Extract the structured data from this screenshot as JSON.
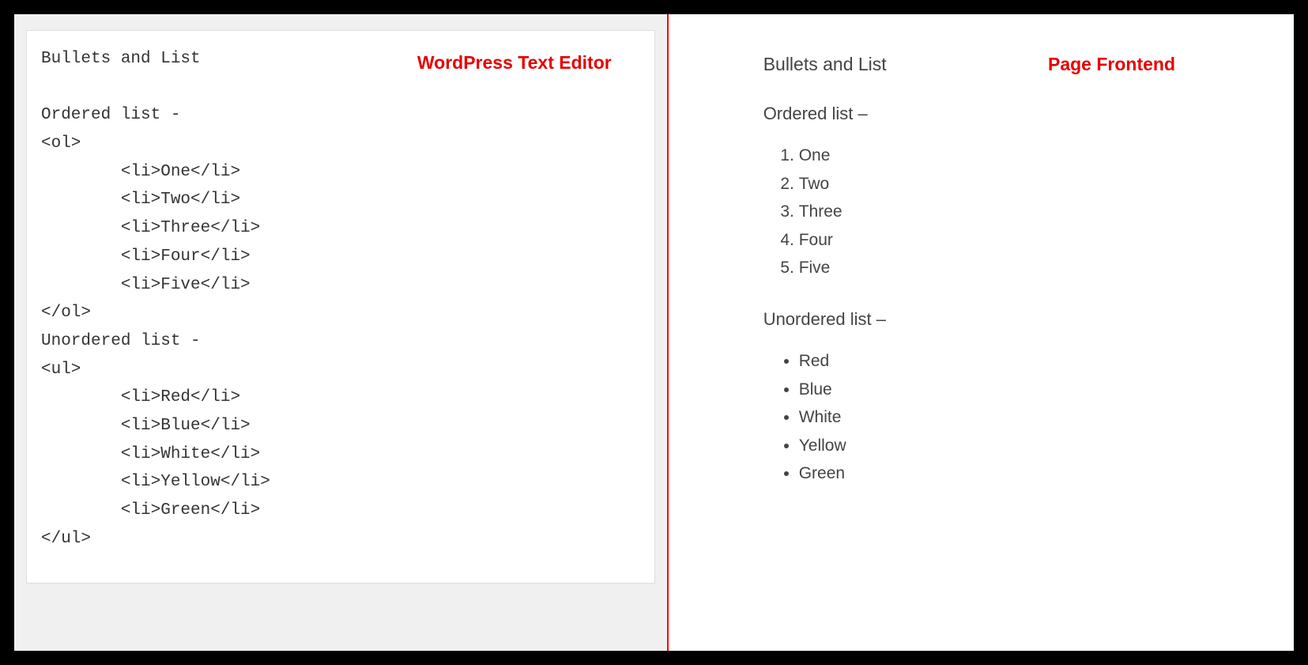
{
  "labels": {
    "editor": "WordPress Text Editor",
    "frontend": "Page Frontend"
  },
  "editor": {
    "lines": [
      "Bullets and List",
      "",
      "Ordered list -",
      "<ol>",
      "        <li>One</li>",
      "        <li>Two</li>",
      "        <li>Three</li>",
      "        <li>Four</li>",
      "        <li>Five</li>",
      "</ol>",
      "Unordered list -",
      "<ul>",
      "        <li>Red</li>",
      "        <li>Blue</li>",
      "        <li>White</li>",
      "        <li>Yellow</li>",
      "        <li>Green</li>",
      "</ul>"
    ]
  },
  "frontend": {
    "title": "Bullets and List",
    "ordered_heading": "Ordered list –",
    "ordered_items": [
      "One",
      "Two",
      "Three",
      "Four",
      "Five"
    ],
    "unordered_heading": "Unordered list –",
    "unordered_items": [
      "Red",
      "Blue",
      "White",
      "Yellow",
      "Green"
    ]
  }
}
